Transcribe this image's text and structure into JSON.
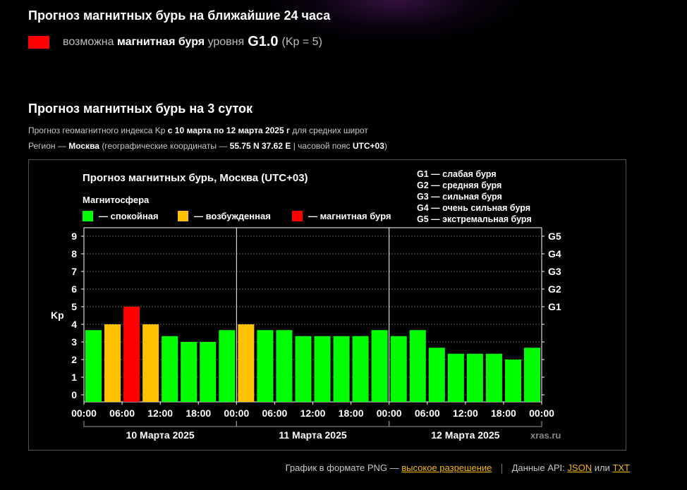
{
  "forecast_24h": {
    "title": "Прогноз магнитных бурь на ближайшие 24 часа",
    "text_pre": "возможна",
    "text_bold": "магнитная буря",
    "text_mid": "уровня",
    "level": "G1.0",
    "kp": "(Kp = 5)"
  },
  "forecast_3d": {
    "title": "Прогноз магнитных бурь на 3 суток",
    "line1_pre": "Прогноз геомагнитного индекса Kp",
    "line1_bold": "с 10 марта по 12 марта 2025 г",
    "line1_post": "для средних широт",
    "line2_pre": "Регион —",
    "line2_region": "Москва",
    "line2_mid": "(географические координаты —",
    "line2_coords": "55.75 N 37.62 E",
    "line2_tz_pre": "| часовой пояс",
    "line2_tz": "UTC+03",
    "line2_close": ")"
  },
  "chart_data": {
    "type": "bar",
    "title": "Прогноз магнитных бурь, Москва (UTC+03)",
    "ylabel": "Kp",
    "ylim": [
      0,
      9
    ],
    "yticks": [
      "0",
      "1",
      "2",
      "3",
      "4",
      "5",
      "6",
      "7",
      "8",
      "9"
    ],
    "g_scale": [
      {
        "kp": 5,
        "label": "G1"
      },
      {
        "kp": 6,
        "label": "G2"
      },
      {
        "kp": 7,
        "label": "G3"
      },
      {
        "kp": 8,
        "label": "G4"
      },
      {
        "kp": 9,
        "label": "G5"
      }
    ],
    "legend_title": "Магнитосфера",
    "legend": [
      {
        "label": "— спокойная",
        "color": "#00ff00"
      },
      {
        "label": "— возбужденная",
        "color": "#ffc000"
      },
      {
        "label": "— магнитная буря",
        "color": "#ff0000"
      }
    ],
    "g_legend": [
      "G1 — слабая буря",
      "G2 — средняя буря",
      "G3 — сильная буря",
      "G4 — очень сильная буря",
      "G5 — экстремальная буря"
    ],
    "xtick_labels": [
      "00:00",
      "06:00",
      "12:00",
      "18:00",
      "00:00",
      "06:00",
      "12:00",
      "18:00",
      "00:00",
      "06:00",
      "12:00",
      "18:00",
      "00:00"
    ],
    "days": [
      "10 Марта 2025",
      "11 Марта 2025",
      "12 Марта 2025"
    ],
    "values": [
      3.67,
      4,
      5,
      4,
      3.33,
      3,
      3,
      3.67,
      4,
      3.67,
      3.67,
      3.33,
      3.33,
      3.33,
      3.33,
      3.67,
      3.33,
      3.67,
      2.67,
      2.33,
      2.33,
      2.33,
      2,
      2.67
    ],
    "colors": {
      "quiet": "#00ff00",
      "active": "#ffc000",
      "storm": "#ff0000"
    },
    "watermark": "xras.ru"
  },
  "footer": {
    "png_text": "График в формате PNG —",
    "png_link": "высокое разрешение",
    "api_text": "Данные API:",
    "json_link": "JSON",
    "or_text": "или",
    "txt_link": "TXT"
  }
}
